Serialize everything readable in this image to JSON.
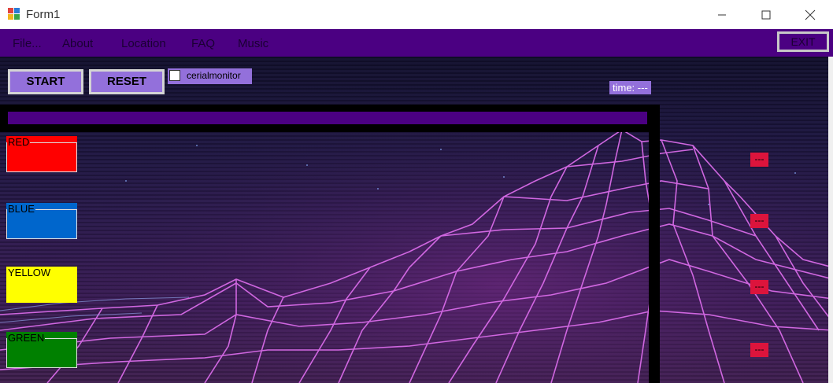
{
  "window": {
    "title": "Form1",
    "minimize_icon": "minimize-icon",
    "maximize_icon": "maximize-icon",
    "close_icon": "close-icon"
  },
  "menu": {
    "items": [
      "File...",
      "About",
      "Location",
      "FAQ",
      "Music"
    ],
    "exit_label": "EXIT"
  },
  "controls": {
    "start_label": "START",
    "reset_label": "RESET",
    "checkbox_label": "cerialmonitor",
    "checkbox_checked": false,
    "time_text": "time:  ---"
  },
  "color_groups": [
    {
      "label": "RED",
      "color": "#ff0000",
      "text_color": "#000000"
    },
    {
      "label": "BLUE",
      "color": "#0066cc",
      "text_color": "#000000"
    },
    {
      "label": "YELLOW",
      "color": "#ffff00",
      "text_color": "#000000"
    },
    {
      "label": "GREEN",
      "color": "#008000",
      "text_color": "#000000"
    }
  ],
  "indicators": [
    "---",
    "---",
    "---",
    "---"
  ],
  "colors": {
    "menu_bar": "#4b0082",
    "button": "#9370db",
    "indicator": "#dc143c"
  }
}
